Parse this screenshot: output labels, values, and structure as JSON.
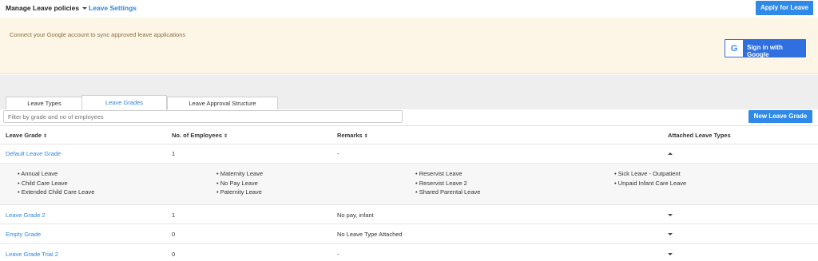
{
  "header": {
    "title": "Manage Leave policies",
    "settings_link": "Leave Settings",
    "apply_button": "Apply for Leave"
  },
  "banner": {
    "message": "Connect your Google account to sync approved leave applications",
    "google_icon": "G",
    "signin_button": "Sign in with Google"
  },
  "tabs": [
    {
      "label": "Leave Types"
    },
    {
      "label": "Leave Grades",
      "active": true
    },
    {
      "label": "Leave Approval Structure"
    }
  ],
  "filter": {
    "placeholder": "Filter by grade and no of employees",
    "value": ""
  },
  "new_grade_button": "New Leave Grade",
  "table": {
    "columns": [
      "Leave Grade",
      "No. of Employees",
      "Remarks",
      "Attached Leave Types"
    ],
    "rows": [
      {
        "grade": "Default Leave Grade",
        "employees": "1",
        "remarks": "-",
        "expanded": true
      },
      {
        "grade": "Leave Grade 2",
        "employees": "1",
        "remarks": "No pay, infant",
        "expanded": false
      },
      {
        "grade": "Empty Grade",
        "employees": "0",
        "remarks": "No Leave Type Attached",
        "expanded": false
      },
      {
        "grade": "Leave Grade Trial 2",
        "employees": "0",
        "remarks": "-",
        "expanded": false
      }
    ],
    "expanded_leave_types": [
      [
        "Annual Leave",
        "Child Care Leave",
        "Extended Child Care Leave"
      ],
      [
        "Maternity Leave",
        "No Pay Leave",
        "Paternity Leave"
      ],
      [
        "Reservist Leave",
        "Reservist Leave 2",
        "Shared Parental Leave"
      ],
      [
        "Sick Leave - Outpatient",
        "Unpaid Infant Care Leave"
      ]
    ]
  },
  "colors": {
    "accent": "#2f89e8",
    "banner_bg": "#fdf5e6",
    "banner_text": "#8a6d3b"
  }
}
